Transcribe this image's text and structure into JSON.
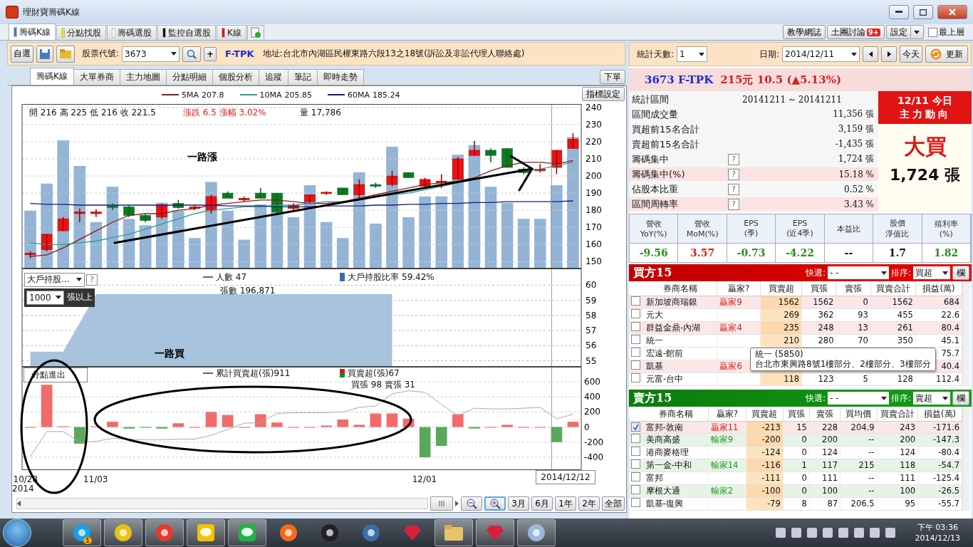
{
  "window": {
    "title": "理財寶籌碼K線"
  },
  "main_tabs": [
    {
      "label": "籌碼K線",
      "color": "#3c78d8",
      "selected": true
    },
    {
      "label": "分點找股",
      "color": "#f2e600",
      "selected": false
    },
    {
      "label": "籌碼選股",
      "color": "#ffffff",
      "selected": false
    },
    {
      "label": "監控自選股",
      "color": "#111111",
      "selected": false
    },
    {
      "label": "K線",
      "color": "#e01010",
      "selected": false
    }
  ],
  "top_buttons": [
    {
      "label": "教學網誌",
      "kind": "plain"
    },
    {
      "label": "土團討論",
      "kind": "badge",
      "badge": "9+"
    },
    {
      "label": "設定",
      "kind": "dropdown"
    }
  ],
  "always_on_top": {
    "label": "最上層",
    "checked": false
  },
  "toolbar": {
    "favorites_button": "自選",
    "code_label": "股票代號:",
    "code_value": "3673",
    "add_button": "+",
    "stock_name": "F-TPK",
    "address": "地址:台北市內湖區民權東路六段13之18號(訴訟及非訟代理人聯絡處)"
  },
  "sub_tabs": [
    {
      "label": "籌碼K線",
      "selected": true
    },
    {
      "label": "大單券商",
      "selected": false
    },
    {
      "label": "主力地圖",
      "selected": false
    },
    {
      "label": "分點明細",
      "selected": false
    },
    {
      "label": "個股分析",
      "selected": false
    },
    {
      "label": "追蹤",
      "selected": false
    },
    {
      "label": "筆記",
      "selected": false
    },
    {
      "label": "即時走勢",
      "selected": false
    }
  ],
  "order_button": "下單",
  "price_panel": {
    "legend_values": [
      "207.8",
      "205.85",
      "185.24"
    ],
    "indicator_button": "指標設定",
    "ohlc": "開 216 高 225 低 216 收 221.5",
    "change": "漲跌 6.5  漲幅  3.02%",
    "volume": "量 17,786",
    "annotation": "一路漲",
    "chart_data": {
      "type": "candlestick",
      "grid": true,
      "ylim": [
        146,
        242
      ],
      "yticks": [
        150,
        160,
        170,
        180,
        190,
        200,
        210,
        220,
        230,
        240
      ],
      "ohlc": [
        [
          154,
          156,
          152,
          155
        ],
        [
          157,
          166,
          156,
          166
        ],
        [
          168,
          176,
          168,
          175
        ],
        [
          178,
          181,
          173,
          179
        ],
        [
          178,
          180.5,
          176,
          179
        ],
        [
          182.5,
          184,
          180,
          182
        ],
        [
          182,
          183,
          176,
          177
        ],
        [
          177,
          178,
          173,
          174
        ],
        [
          176,
          184,
          175,
          183
        ],
        [
          184,
          186,
          181,
          181.5
        ],
        [
          181,
          183,
          180,
          182
        ],
        [
          180,
          189,
          178,
          188
        ],
        [
          190,
          191,
          187,
          187
        ],
        [
          186,
          188,
          185,
          187
        ],
        [
          190,
          193,
          187,
          187
        ],
        [
          190,
          190,
          177,
          179
        ],
        [
          181,
          184,
          179,
          183
        ],
        [
          185,
          189,
          184,
          189
        ],
        [
          190,
          191,
          189,
          190.5
        ],
        [
          193,
          193,
          189,
          189
        ],
        [
          189,
          198,
          186,
          195
        ],
        [
          195,
          196,
          193,
          194
        ],
        [
          195,
          203,
          194,
          200
        ],
        [
          202,
          202,
          199,
          199
        ],
        [
          194,
          199,
          193,
          198
        ],
        [
          196,
          201,
          193,
          197
        ],
        [
          198,
          211,
          198,
          210
        ],
        [
          212,
          220.5,
          212,
          215
        ],
        [
          215,
          216,
          208,
          212
        ],
        [
          216,
          216,
          205,
          205
        ],
        [
          204,
          205,
          201,
          202
        ],
        [
          203,
          207,
          202,
          204
        ],
        [
          205,
          215,
          201,
          215
        ],
        [
          216,
          225,
          216,
          221.5
        ]
      ],
      "series": [
        {
          "name": "5MA",
          "type": "line",
          "color": "#8b1a1a",
          "values": [
            153,
            154,
            158,
            163,
            168,
            173,
            177,
            178,
            178,
            180,
            181,
            183,
            184,
            185,
            186,
            186,
            185,
            184,
            184,
            185,
            187,
            189,
            191,
            193,
            195,
            196,
            197,
            199,
            203,
            206,
            208,
            208,
            207,
            209
          ]
        },
        {
          "name": "10MA",
          "type": "line",
          "color": "#2a9d96",
          "values": [
            161,
            160,
            160,
            161,
            162,
            164,
            166,
            169,
            172,
            175,
            178,
            180,
            181,
            182,
            182,
            183,
            183,
            184,
            185,
            185,
            186,
            188,
            189,
            190,
            192,
            194,
            196,
            198,
            200,
            202,
            203,
            204,
            206,
            208
          ]
        },
        {
          "name": "60MA",
          "type": "line",
          "color": "#1a1a7a",
          "values": [
            184,
            183.5,
            183.5,
            183,
            183,
            183,
            183,
            183,
            183,
            183,
            183,
            183,
            182.5,
            182.5,
            182.5,
            182,
            182,
            182,
            182.5,
            182.5,
            182.5,
            183,
            183,
            183.5,
            183.5,
            184,
            184,
            184.5,
            184.5,
            185,
            185,
            185,
            185,
            185.5
          ]
        }
      ]
    }
  },
  "holder_panel": {
    "selector": "大戶持股...",
    "help": "?",
    "threshold_value": "1000",
    "threshold_label": "張以上",
    "legend_people": "人數 47",
    "legend_shares": "張數 196,871",
    "legend_ratio_value": " 59.42%",
    "annotation": "一路買",
    "chart_data": {
      "type": "area",
      "grid": true,
      "ylim": [
        54.6,
        61.1
      ],
      "yticks": [
        55,
        56,
        57,
        58,
        59,
        60
      ],
      "series": [
        {
          "name": "大戶持股比率",
          "color": "#a7c3de",
          "values": [
            55.6,
            55.6,
            55.6,
            57.5,
            59.4,
            59.4,
            59.4,
            59.4,
            59.4,
            59.4,
            59.4,
            59.4,
            59.4,
            59.4,
            59.4,
            59.4,
            59.4,
            59.4,
            59.4,
            59.4,
            59.4,
            59.4,
            59.4,
            null,
            null,
            null,
            null,
            null,
            null,
            null,
            null,
            null,
            null,
            null
          ]
        }
      ]
    }
  },
  "branch_panel": {
    "title": "分點進出",
    "legend_cumulative_value": "911",
    "legend_net_value": "67",
    "legend_detail": "買張 98 賣張 31",
    "chart_data": {
      "type": "bar",
      "grid": true,
      "ylim": [
        -570,
        798
      ],
      "yticks": [
        -400,
        -200,
        0,
        200,
        400,
        600
      ],
      "series": [
        {
          "name": "買賣超(張)",
          "type": "bar",
          "color": "#f26b6b",
          "values": [
            0,
            560,
            10,
            null,
            10,
            70,
            null,
            null,
            null,
            50,
            0,
            200,
            160,
            0,
            170,
            60,
            0,
            0,
            20,
            100,
            30,
            180,
            180,
            110,
            null,
            null,
            170,
            null,
            0,
            30,
            0,
            0,
            null,
            70
          ]
        },
        {
          "type": "bar",
          "color": "#5aa85a",
          "values": [
            null,
            null,
            null,
            -220,
            null,
            null,
            -20,
            -10,
            -20,
            null,
            null,
            null,
            null,
            null,
            null,
            null,
            null,
            null,
            null,
            null,
            null,
            null,
            null,
            null,
            -400,
            -250,
            null,
            -20,
            null,
            null,
            null,
            null,
            -200,
            null
          ]
        },
        {
          "name": "累計買賣超(張)",
          "type": "line",
          "color": "#aaaaaa",
          "values": [
            -390,
            -60,
            -60,
            -200,
            -190,
            -150,
            -160,
            -170,
            -170,
            -160,
            -160,
            -110,
            -30,
            50,
            60,
            180,
            190,
            190,
            190,
            200,
            260,
            280,
            440,
            480,
            460,
            300,
            150,
            250,
            240,
            240,
            250,
            260,
            110,
            170
          ]
        }
      ]
    }
  },
  "x_axis": {
    "labels": [
      "10/28",
      "11/03",
      "12/01"
    ],
    "year": "2014",
    "cursor": "2014/12/12"
  },
  "range_buttons": [
    {
      "label": "3月"
    },
    {
      "label": "6月"
    },
    {
      "label": "1年"
    },
    {
      "label": "2年"
    },
    {
      "label": "全部"
    }
  ],
  "stats": {
    "days_label": "統計天數:",
    "days_value": "1",
    "date_label": "日期:",
    "date_value": "2014/12/11",
    "today_button": "今天",
    "refresh_button": "更新"
  },
  "quote": {
    "symbol": "3673 F-TPK",
    "price": "215元 10.5 (▲5.13%)"
  },
  "summary": [
    {
      "label": "統計區間",
      "value": "20141211 ~ 20141211",
      "kind": "range",
      "highlight": false
    },
    {
      "label": "區間成交量",
      "value": "11,356 張",
      "kind": "amount",
      "highlight": false
    },
    {
      "label": "買超前15名合計",
      "value": "3,159 張",
      "kind": "amount",
      "highlight": false
    },
    {
      "label": "賣超前15名合計",
      "value": "-1,435 張",
      "kind": "amount",
      "highlight": false
    },
    {
      "label": "籌碼集中",
      "value": "1,724 張",
      "kind": "amount",
      "help": "?",
      "highlight": false
    },
    {
      "label": "籌碼集中(%)",
      "value": "15.18 %",
      "kind": "amount",
      "help": "?",
      "highlight": true
    },
    {
      "label": "佔股本比重",
      "value": "0.52 %",
      "kind": "amount",
      "help": "?",
      "highlight": false
    },
    {
      "label": "區間周轉率",
      "value": "3.43 %",
      "kind": "amount",
      "help": "?",
      "highlight": true
    }
  ],
  "signal": {
    "date": "12/11 今日",
    "title": "主力動向",
    "verdict": "大買",
    "amount": "1,724 張"
  },
  "metrics": [
    {
      "label": [
        "營收",
        "YoY(%)"
      ],
      "value": "-9.56",
      "color": "#2e8b1e"
    },
    {
      "label": [
        "營收",
        "MoM(%)"
      ],
      "value": "3.57",
      "color": "#d42020"
    },
    {
      "label": [
        "EPS",
        "(季)"
      ],
      "value": "-0.73",
      "color": "#2e8b1e"
    },
    {
      "label": [
        "EPS",
        "(近4季)"
      ],
      "value": "-4.22",
      "color": "#2e8b1e"
    },
    {
      "label": [
        "本益比"
      ],
      "value": "--",
      "color": "#111111"
    },
    {
      "label": [
        "股價",
        "淨值比"
      ],
      "value": "1.7",
      "color": "#111111"
    },
    {
      "label": [
        "殖利率",
        "(%)"
      ],
      "value": "1.82",
      "color": "#2e8b1e"
    }
  ],
  "buyers": {
    "title": "買方15",
    "quick_label": "快選:",
    "quick_value": "- -",
    "sort_label": "排序:",
    "sort_value": "買超",
    "columns_button": "欄",
    "name_header": "券商名稱",
    "tag_header": "贏家?",
    "columns": [
      "買賣超",
      "買張",
      "賣張",
      "買賣合計",
      "損益(萬)"
    ],
    "rows": [
      {
        "checked": false,
        "name": "新加坡商瑞銀",
        "tag": "贏家9",
        "kind": "winner",
        "cells": [
          "1562",
          "1562",
          "0",
          "1562",
          "684"
        ]
      },
      {
        "checked": false,
        "name": "元大",
        "kind": "none",
        "cells": [
          "269",
          "362",
          "93",
          "455",
          "22.6"
        ]
      },
      {
        "checked": false,
        "name": "群益金鼎-內湖",
        "tag": "贏家4",
        "kind": "winner",
        "cells": [
          "235",
          "248",
          "13",
          "261",
          "80.4"
        ]
      },
      {
        "checked": false,
        "name": "統一",
        "kind": "none",
        "cells": [
          "210",
          "280",
          "70",
          "350",
          "45.1"
        ]
      },
      {
        "checked": false,
        "name": "宏遠-館前",
        "kind": "none",
        "cells": [
          null,
          null,
          null,
          null,
          "75.7"
        ]
      },
      {
        "checked": false,
        "name": "凱基",
        "tag": "贏家6",
        "kind": "winner",
        "cells": [
          null,
          null,
          null,
          null,
          "40.4"
        ]
      },
      {
        "checked": false,
        "name": "元富-台中",
        "kind": "none",
        "cells": [
          "118",
          "123",
          "5",
          "128",
          "112.4"
        ]
      }
    ],
    "tooltip": {
      "title": "統一 (5850)",
      "address": "台北市東興路8號1樓部分、2樓部分、3樓部分"
    }
  },
  "sellers": {
    "title": "賣方15",
    "quick_label": "快選:",
    "quick_value": "- -",
    "sort_label": "排序:",
    "sort_value": "賣超",
    "columns_button": "欄",
    "name_header": "券商名稱",
    "tag_header": "贏家?",
    "columns": [
      "買賣超",
      "買張",
      "賣張",
      "買均價",
      "買賣合計",
      "損益(萬)"
    ],
    "rows": [
      {
        "checked": true,
        "name": "富邦-敦南",
        "tag": "贏家11",
        "kind": "winner",
        "cells": [
          "-213",
          "15",
          "228",
          "204.9",
          "243",
          "-171.6"
        ]
      },
      {
        "checked": false,
        "name": "美商高盛",
        "tag": "輸家9",
        "kind": "loser",
        "cells": [
          "-200",
          "0",
          "200",
          "--",
          "200",
          "-147.3"
        ]
      },
      {
        "checked": false,
        "name": "港商麥格理",
        "kind": "none",
        "cells": [
          "-124",
          "0",
          "124",
          "--",
          "124",
          "-80.4"
        ]
      },
      {
        "checked": false,
        "name": "第一金-中和",
        "tag": "輸家14",
        "kind": "loser",
        "cells": [
          "-116",
          "1",
          "117",
          "215",
          "118",
          "-54.7"
        ]
      },
      {
        "checked": false,
        "name": "富邦",
        "kind": "none",
        "cells": [
          "-111",
          "0",
          "111",
          "--",
          "111",
          "-125.4"
        ]
      },
      {
        "checked": false,
        "name": "摩根大通",
        "tag": "輸家2",
        "kind": "loser",
        "cells": [
          "-100",
          "0",
          "100",
          "--",
          "100",
          "-26.5"
        ]
      },
      {
        "checked": false,
        "name": "凱基-復興",
        "kind": "none",
        "cells": [
          "-79",
          "8",
          "87",
          "206.5",
          "95",
          "-55.7"
        ]
      }
    ]
  },
  "taskbar": {
    "apps": [
      {
        "kind": "chat",
        "badge": "1",
        "running": true
      },
      {
        "kind": "browser",
        "running": true
      },
      {
        "kind": "e",
        "running": true
      },
      {
        "kind": "yellow",
        "running": true
      },
      {
        "kind": "line",
        "running": true
      },
      {
        "kind": "swirl",
        "running": false
      },
      {
        "kind": "penguin",
        "running": false
      },
      {
        "kind": "globe",
        "running": false
      },
      {
        "kind": "gem",
        "running": false
      },
      {
        "kind": "folder",
        "running": true
      },
      {
        "kind": "gem",
        "running": true
      },
      {
        "kind": "palette",
        "running": true
      }
    ],
    "clock_time": "下午 03:36",
    "clock_date": "2014/12/13"
  }
}
